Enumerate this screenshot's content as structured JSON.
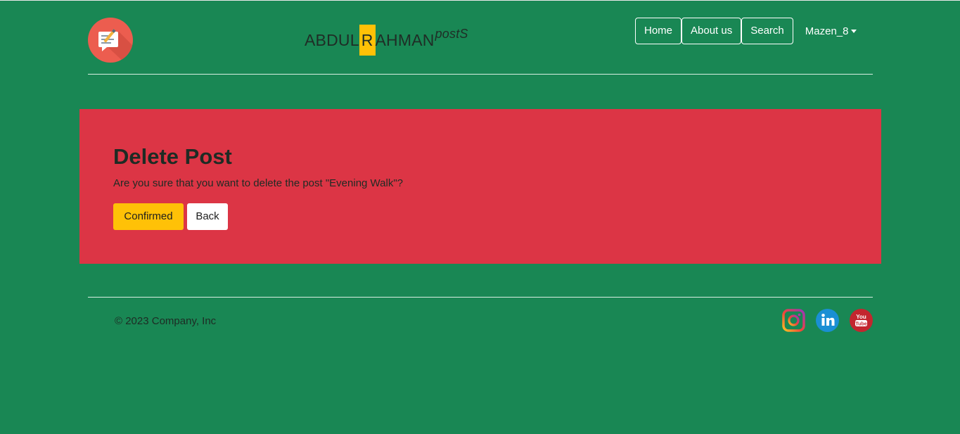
{
  "header": {
    "logo_icon": "notepad-pencil-icon",
    "brand": {
      "part1": "ABDUL",
      "highlight": "R",
      "part2": "AHMAN",
      "suffix": "postS"
    },
    "nav": {
      "home": "Home",
      "about": "About us",
      "search": "Search",
      "user": "Mazen_8"
    }
  },
  "delete_panel": {
    "title": "Delete Post",
    "message": "Are you sure that you want to delete the post \"Evening Walk\"?",
    "confirm_label": "Confirmed",
    "back_label": "Back"
  },
  "footer": {
    "copyright": "© 2023 Company, Inc",
    "social": [
      "instagram-icon",
      "linkedin-icon",
      "youtube-icon"
    ]
  },
  "colors": {
    "page_bg": "#198754",
    "panel_bg": "#dc3545",
    "highlight": "#ffc107",
    "logo_bg": "#ec5d4f"
  }
}
